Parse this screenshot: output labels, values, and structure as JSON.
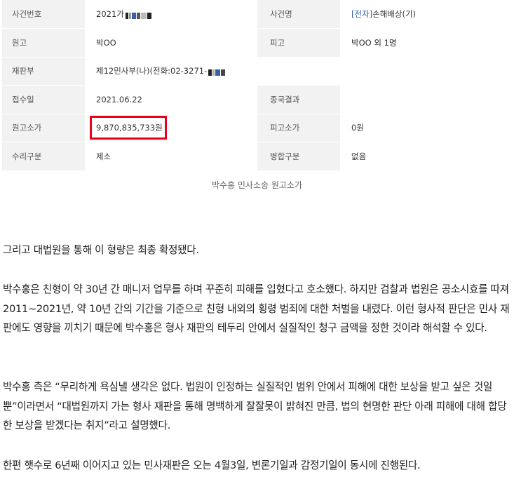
{
  "case_table": {
    "rows": [
      {
        "label1": "사건번호",
        "value1": "2021가",
        "label2": "사건명",
        "value2_tag": "[전자]",
        "value2": "손해배상(기)"
      },
      {
        "label1": "원고",
        "value1": "박OO",
        "label2": "피고",
        "value2": "박OO 외 1명"
      },
      {
        "label1": "재판부",
        "value1": "제12민사부(나)(전화:02-3271-"
      },
      {
        "label1": "접수일",
        "value1": "2021.06.22",
        "label2": "종국결과",
        "value2": ""
      },
      {
        "label1": "원고소가",
        "value1": "9,870,835,733원",
        "label2": "피고소가",
        "value2": "0원"
      },
      {
        "label1": "수리구분",
        "value1": "제소",
        "label2": "병합구분",
        "value2": "없음"
      }
    ],
    "highlight_color": "#e8001c",
    "label_bg": "#f2f2f2"
  },
  "caption": "박수홍 민사소송 원고소가",
  "article": {
    "paragraphs": [
      "그리고 대법원을 통해 이 형량은 최종 확정됐다.",
      "박수홍은 친형이 약 30년 간 매니저 업무를 하며 꾸준히 피해를 입혔다고 호소했다. 하지만 검찰과 법원은 공소시효를 따져 2011~2021년, 약 10년 간의 기간을 기준으로 친형 내외의 횡령 범죄에 대한 처벌을 내렸다. 이런 형사적 판단은 민사 재판에도 영향을 끼치기 때문에 박수홍은 형사 재판의 테두리 안에서 실질적인 청구 금액을 정한 것이라 해석할 수 있다.",
      "박수홍 측은 “무리하게 욕심낼 생각은 없다. 법원이 인정하는 실질적인 범위 안에서 피해에 대한 보상을 받고 싶은 것일 뿐”이라면서 “대법원까지 가는 형사 재판을 통해 명백하게 잘잘못이 밝혀진 만큼, 법의 현명한 판단 아래 피해에 대해 합당한 보상을 받겠다는 취지”라고 설명했다.",
      "한편 햇수로 6년째 이어지고 있는 민사재판은 오는 4월3일, 변론기일과 감정기일이 동시에 진행된다."
    ]
  }
}
